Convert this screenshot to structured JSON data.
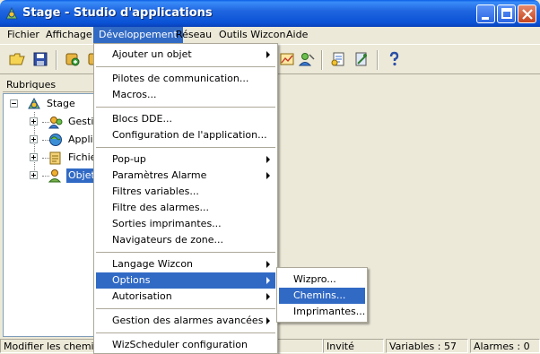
{
  "window": {
    "title": "Stage - Studio d'applications"
  },
  "menubar": {
    "items": [
      "Fichier",
      "Affichage",
      "Développement",
      "Réseau",
      "Outils Wizcon",
      "Aide"
    ]
  },
  "panel": {
    "header": "Rubriques"
  },
  "tree": {
    "root": "Stage",
    "children": [
      "Gestio",
      "Applic",
      "Fichier",
      "Objet"
    ]
  },
  "dev_menu": {
    "items": [
      "Ajouter un objet",
      "Pilotes de communication...",
      "Macros...",
      "Blocs DDE...",
      "Configuration de l'application...",
      "Pop-up",
      "Paramètres Alarme",
      "Filtres variables...",
      "Filtre des alarmes...",
      "Sorties imprimantes...",
      "Navigateurs de zone...",
      "Langage Wizcon",
      "Options",
      "Autorisation",
      "Gestion des alarmes avancées",
      "WizScheduler configuration"
    ]
  },
  "options_menu": {
    "items": [
      "Wizpro...",
      "Chemins...",
      "Imprimantes..."
    ]
  },
  "statusbar": {
    "message": "Modifier les chemins p",
    "user": "Invité",
    "variables": "Variables : 57",
    "alarms": "Alarmes : 0"
  },
  "colors": {
    "highlight": "#316ac5",
    "titlebar": "#0a52d6",
    "face": "#ece9d8"
  }
}
